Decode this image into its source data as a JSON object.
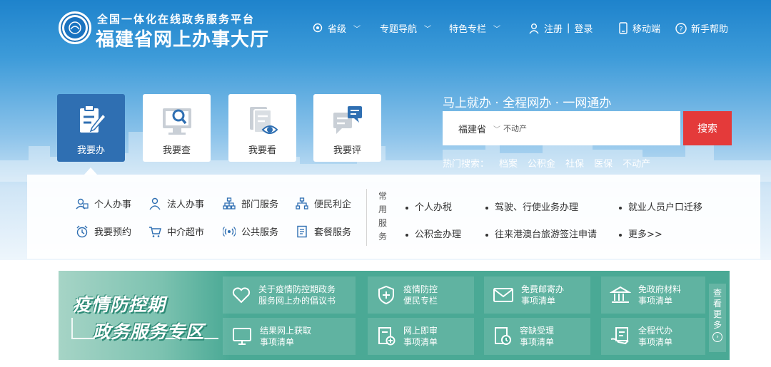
{
  "header": {
    "subtitle": "全国一体化在线政务服务平台",
    "title": "福建省网上办事大厅",
    "nav": {
      "region": "省级",
      "topics": "专题导航",
      "special": "特色专栏",
      "register": "注册",
      "separator": "|",
      "login": "登录",
      "mobile": "移动端",
      "help": "新手帮助"
    }
  },
  "tiles": [
    {
      "label": "我要办",
      "active": true
    },
    {
      "label": "我要查",
      "active": false
    },
    {
      "label": "我要看",
      "active": false
    },
    {
      "label": "我要评",
      "active": false
    }
  ],
  "search": {
    "slogan": "马上就办 · 全程网办 · 一网通办",
    "region": "福建省",
    "placeholder": "不动产",
    "button": "搜索",
    "hot_label": "热门搜索：",
    "hot": [
      "档案",
      "公积金",
      "社保",
      "医保",
      "不动产"
    ]
  },
  "services": {
    "row1": [
      "个人办事",
      "法人办事",
      "部门服务",
      "便民利企"
    ],
    "row2": [
      "我要预约",
      "中介超市",
      "公共服务",
      "套餐服务"
    ],
    "common_title": "常用服务",
    "common_col1": [
      "个人办税",
      "公积金办理"
    ],
    "common_col2": [
      "驾驶、行使业务办理",
      "往来港澳台旅游签注申请"
    ],
    "common_col3": [
      "就业人员户口迁移",
      "更多>>"
    ]
  },
  "zone": {
    "title1": "疫情防控期",
    "title2": "政务服务专区",
    "cards": [
      {
        "l1": "关于疫情防控期政务",
        "l2": "服务网上办的倡议书",
        "icon": "heart-icon"
      },
      {
        "l1": "疫情防控",
        "l2": "便民专栏",
        "icon": "shield-plus-icon"
      },
      {
        "l1": "免费邮寄办",
        "l2": "事项清单",
        "icon": "mail-icon"
      },
      {
        "l1": "免政府材料",
        "l2": "事项清单",
        "icon": "building-icon"
      },
      {
        "l1": "结果网上获取",
        "l2": "事项清单",
        "icon": "monitor-icon"
      },
      {
        "l1": "网上即审",
        "l2": "事项清单",
        "icon": "doc-plus-icon"
      },
      {
        "l1": "容缺受理",
        "l2": "事项清单",
        "icon": "doc-clock-icon"
      },
      {
        "l1": "全程代办",
        "l2": "事项清单",
        "icon": "hand-doc-icon"
      }
    ],
    "more": [
      "查",
      "看",
      "更",
      "多"
    ],
    "more_arrow": "›"
  },
  "colors": {
    "header_blue": "#1e83cc",
    "active_tile": "#2f6fb2",
    "search_button": "#e43a3a",
    "zone_green": "#4aa995",
    "icon_blue": "#2f6fb2"
  }
}
